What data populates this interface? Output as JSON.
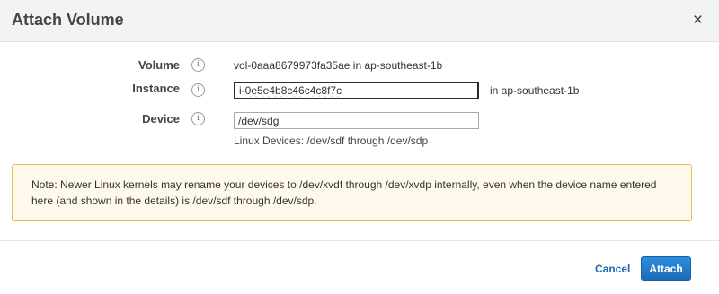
{
  "dialog": {
    "title": "Attach Volume",
    "close_glyph": "×"
  },
  "form": {
    "volume": {
      "label": "Volume",
      "value": "vol-0aaa8679973fa35ae in ap-southeast-1b"
    },
    "instance": {
      "label": "Instance",
      "value": "i-0e5e4b8c46c4c8f7c",
      "suffix": "in ap-southeast-1b"
    },
    "device": {
      "label": "Device",
      "value": "/dev/sdg",
      "hint": "Linux Devices: /dev/sdf through /dev/sdp"
    },
    "info_glyph": "i"
  },
  "note": {
    "text": "Note: Newer Linux kernels may rename your devices to /dev/xvdf through /dev/xvdp internally, even when the device name entered here (and shown in the details) is /dev/sdf through /dev/sdp."
  },
  "footer": {
    "cancel_label": "Cancel",
    "attach_label": "Attach"
  },
  "colors": {
    "primary": "#1b6cb7",
    "note_border": "#eab94a",
    "note_background": "#fff9ec"
  }
}
